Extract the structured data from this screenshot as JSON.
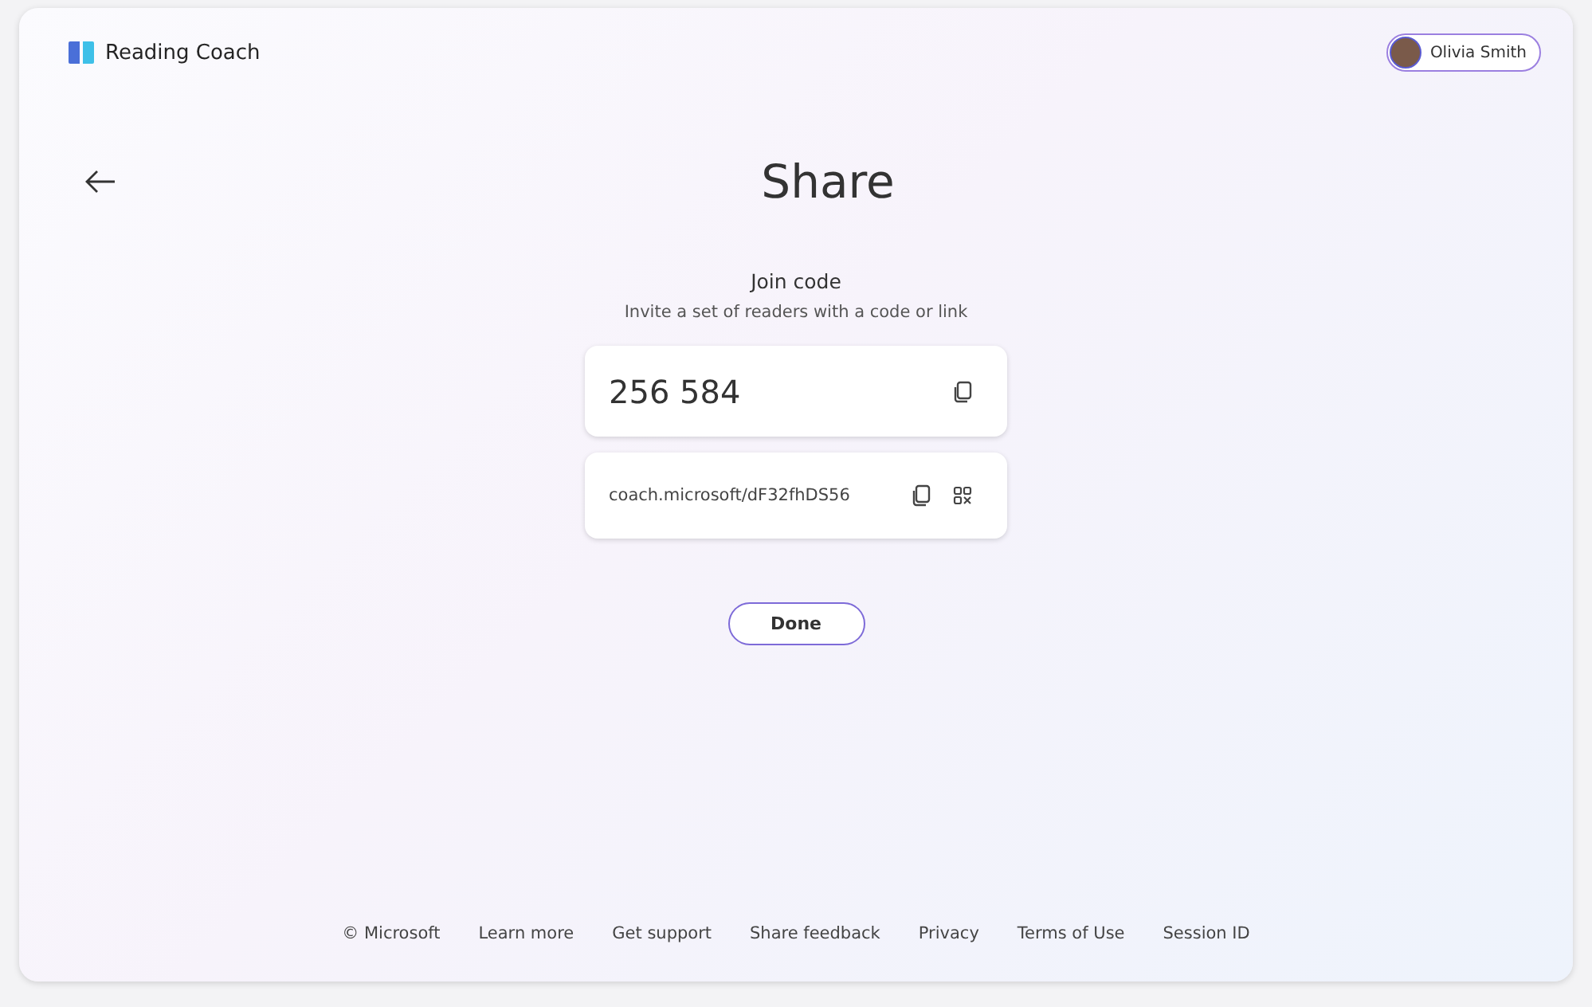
{
  "app": {
    "name": "Reading Coach"
  },
  "user": {
    "name": "Olivia Smith"
  },
  "page": {
    "title": "Share"
  },
  "join": {
    "heading": "Join code",
    "subtitle": "Invite a set of readers with a code or link",
    "code": "256 584",
    "link": "coach.microsoft/dF32fhDS56"
  },
  "done_button": "Done",
  "footer": {
    "copyright": "© Microsoft",
    "links": [
      "Learn more",
      "Get support",
      "Share feedback",
      "Privacy",
      "Terms of Use",
      "Session ID"
    ]
  }
}
